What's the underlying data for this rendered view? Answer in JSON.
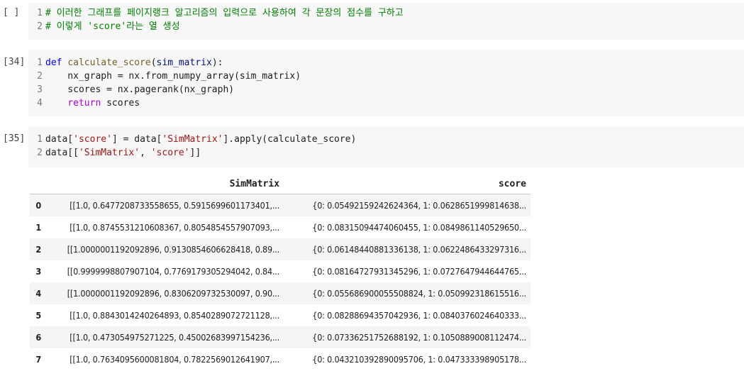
{
  "cells": [
    {
      "prompt": "[ ]",
      "lines": [
        {
          "n": "1",
          "text": "# 이러한 그래프를 페이지랭크 알고리즘의 입력으로 사용하여 각 문장의 점수를 구하고"
        },
        {
          "n": "2",
          "text": "# 이렇게 'score'라는 열 생성"
        }
      ]
    },
    {
      "prompt": "[34]",
      "lines": [
        {
          "n": "1",
          "kw": "def",
          "name": "calculate_score",
          "arg": "sim_matrix",
          "close": "):"
        },
        {
          "n": "2",
          "text": "    nx_graph = nx.from_numpy_array(sim_matrix)"
        },
        {
          "n": "3",
          "text": "    scores = nx.pagerank(nx_graph)"
        },
        {
          "n": "4",
          "kw": "return",
          "text": " scores"
        }
      ]
    },
    {
      "prompt": "[35]",
      "lines": [
        {
          "n": "1",
          "a": "data[",
          "s1": "'score'",
          "b": "] = data[",
          "s2": "'SimMatrix'",
          "c": "].apply(calculate_score)"
        },
        {
          "n": "2",
          "a": "data[[",
          "s1": "'SimMatrix'",
          "b": ", ",
          "s2": "'score'",
          "c": "]]"
        }
      ]
    }
  ],
  "table": {
    "columns": [
      "",
      "SimMatrix",
      "score"
    ],
    "rows": [
      [
        "0",
        "[[1.0, 0.6477208733558655, 0.5915699601173401,...",
        "{0: 0.05492159242624364, 1: 0.0628651999814638..."
      ],
      [
        "1",
        "[[1.0, 0.8745531210608367, 0.8054854557907093,...",
        "{0: 0.08315094474060455, 1: 0.0849861140529650..."
      ],
      [
        "2",
        "[[1.0000001192092896, 0.9130854606628418, 0.89...",
        "{0: 0.06148440881336138, 1: 0.0622486433297316..."
      ],
      [
        "3",
        "[[0.9999998807907104, 0.7769179305294042, 0.84...",
        "{0: 0.08164727931345296, 1: 0.0727647944644765..."
      ],
      [
        "4",
        "[[1.0000001192092896, 0.8306209732530097, 0.90...",
        "{0: 0.055686900055508824, 1: 0.050992318615516..."
      ],
      [
        "5",
        "[[1.0, 0.8843014240264893, 0.8540289072721128,...",
        "{0: 0.08288694357042936, 1: 0.0840376024640333..."
      ],
      [
        "6",
        "[[1.0, 0.473054975271225, 0.45002683997154236,...",
        "{0: 0.07336251752688192, 1: 0.1050889008112474..."
      ],
      [
        "7",
        "[[1.0, 0.7634095600081804, 0.7822569012641907,...",
        "{0: 0.043210392890095706, 1: 0.047333398905178..."
      ]
    ]
  }
}
